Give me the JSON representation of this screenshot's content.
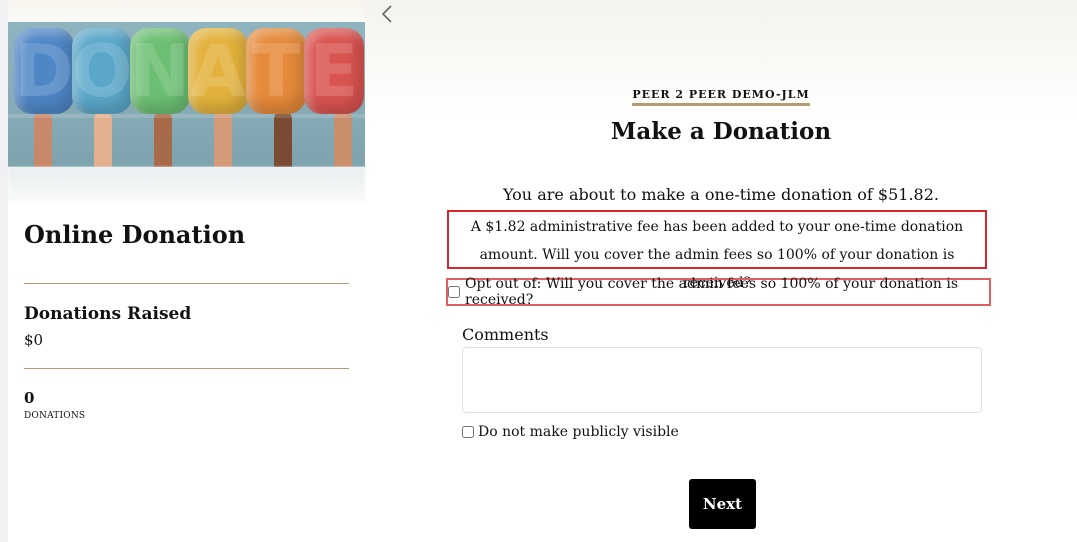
{
  "campaign": {
    "hero_letters": [
      "D",
      "O",
      "N",
      "A",
      "T",
      "E"
    ],
    "title": "Online Donation",
    "donations_raised_label": "Donations Raised",
    "donations_raised_value": "$0",
    "donations_count": "0",
    "donations_count_label": "DONATIONS"
  },
  "form": {
    "back_icon": "chevron-left-icon",
    "subtitle": "PEER 2 PEER DEMO-JLM",
    "heading": "Make a Donation",
    "summary": "You are about to make a one-time donation of $51.82.",
    "fee_notice": "A $1.82 administrative fee has been added to your one-time donation amount. Will you cover the admin fees so 100% of your donation is received?",
    "opt_out_label": "Opt out of: Will you cover the admin fees so 100% of your donation is received?",
    "opt_out_checked": false,
    "comments_label": "Comments",
    "comments_value": "",
    "private_label": "Do not make publicly visible",
    "private_checked": false,
    "next_label": "Next"
  },
  "colors": {
    "accent_gold": "#b79b72",
    "highlight_red": "#d9262c",
    "button_bg": "#000000"
  }
}
